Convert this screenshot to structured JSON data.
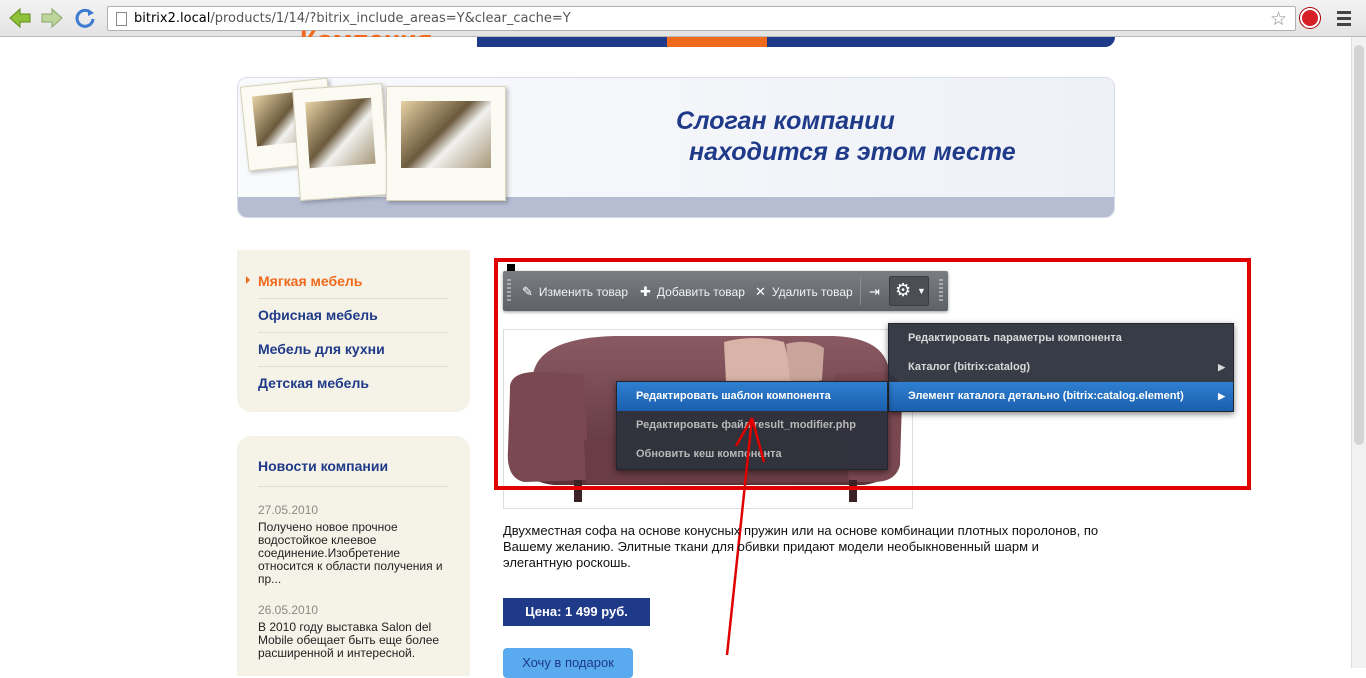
{
  "browser": {
    "url_host": "bitrix2.local",
    "url_path": "/products/1/14/?bitrix_include_areas=Y&clear_cache=Y"
  },
  "site": {
    "logo_text": "Компания",
    "slogan_line1": "Слоган компании",
    "slogan_line2": "находится в этом месте"
  },
  "left_menu": {
    "items": [
      {
        "label": "Мягкая мебель",
        "selected": true
      },
      {
        "label": "Офисная мебель"
      },
      {
        "label": "Мебель для кухни"
      },
      {
        "label": "Детская мебель"
      }
    ]
  },
  "news": {
    "title": "Новости компании",
    "items": [
      {
        "date": "27.05.2010",
        "text": "Получено новое прочное водостойкое клеевое соединение.Изобретение относится к области получения и пр..."
      },
      {
        "date": "26.05.2010",
        "text": "В 2010 году выставка Salon del Mobile обещает быть еще более расширенной и интересной."
      }
    ]
  },
  "toolbar": {
    "edit_label": "Изменить товар",
    "add_label": "Добавить товар",
    "delete_label": "Удалить товар"
  },
  "context_menu_main": {
    "items": [
      {
        "label": "Редактировать параметры компонента"
      },
      {
        "label": "Каталог (bitrix:catalog)",
        "has_submenu": true
      },
      {
        "label": "Элемент каталога детально (bitrix:catalog.element)",
        "has_submenu": true,
        "highlighted": true
      }
    ]
  },
  "context_menu_sub": {
    "items": [
      {
        "label": "Редактировать шаблон компонента",
        "highlighted": true
      },
      {
        "label": "Редактировать файл result_modifier.php"
      },
      {
        "label": "Обновить кеш компонента"
      }
    ]
  },
  "product": {
    "description": "Двухместная софа на основе конусных пружин или на основе комбинации плотных поролонов, по Вашему желанию. Элитные ткани для обивки придают модели необыкновенный шарм и элегантную роскошь.",
    "price": "Цена: 1 499 руб.",
    "order_button": "Хочу в подарок"
  },
  "colors": {
    "brand_blue": "#1f3a88",
    "brand_orange": "#f06a1e",
    "highlight_red": "#e00000",
    "menu_highlight": "#2f7fd0"
  }
}
